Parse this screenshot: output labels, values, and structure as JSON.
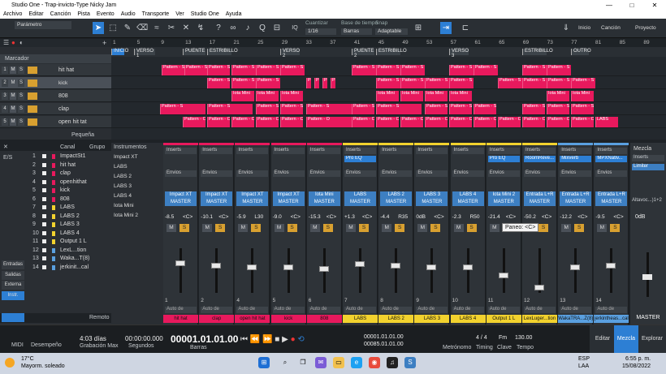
{
  "window": {
    "title": "Studio One - Trap-invicto-Type Nicky Jam",
    "min": "—",
    "max": "□",
    "close": "✕"
  },
  "menu": [
    "Archivo",
    "Editar",
    "Canción",
    "Pista",
    "Evento",
    "Audio",
    "Transporte",
    "Ver",
    "Studio One",
    "Ayuda"
  ],
  "toolbar": {
    "param": "Parámetro",
    "quantize_label": "Cuantizar",
    "quantize_value": "1/16",
    "timebase_label": "Base de tiempo",
    "timebase_value": "Barras",
    "snap_label": "Snap",
    "snap_value": "Adaptable",
    "iq": "IQ",
    "home": "Inicio",
    "song": "Canción",
    "project": "Proyecto"
  },
  "ruler": [
    "1",
    "5",
    "9",
    "13",
    "17",
    "21",
    "25",
    "29",
    "33",
    "37",
    "41",
    "45",
    "49",
    "53",
    "57",
    "61",
    "65",
    "69",
    "73",
    "77",
    "81",
    "85",
    "89"
  ],
  "markers": [
    {
      "label": "INICIO"
    },
    {
      "label": "VERSO 1"
    },
    {
      "label": "PUENTE"
    },
    {
      "label": "ESTRIBILLO"
    },
    {
      "label": "VERSO 2"
    },
    {
      "label": "PUENTE 2"
    },
    {
      "label": "ESTRIBILLO"
    },
    {
      "label": "VERSO 3"
    },
    {
      "label": "ESTRIBILLO"
    },
    {
      "label": "OUTRO"
    }
  ],
  "tracks_header": {
    "title": "Marcador"
  },
  "tracks": [
    {
      "n": "1",
      "name": "hit hat"
    },
    {
      "n": "2",
      "name": "kick"
    },
    {
      "n": "3",
      "name": "808"
    },
    {
      "n": "4",
      "name": "clap"
    },
    {
      "n": "5",
      "name": "open hit tat"
    }
  ],
  "clip_labels": {
    "pattern": "Pattern - S",
    "iota": "Iota Mini",
    "patO": "Pattern - O",
    "labs": "LABS"
  },
  "size": "Pequeña",
  "channel_list": {
    "header_canal": "Canal",
    "header_grupo": "Grupo",
    "header_inst": "Instrumentos",
    "items": [
      "ImpactSt1",
      "hit hat",
      "clap",
      "openhithat",
      "kick",
      "808",
      "LABS",
      "LABS 2",
      "LABS 3",
      "LABS 4",
      "Output 1 L",
      "LexL...tion",
      "Waka...T(8)",
      "jerkinit...cal"
    ],
    "nums": [
      "1",
      "2",
      "3",
      "4",
      "5",
      "6",
      "7",
      "8",
      "9",
      "10",
      "11",
      "12",
      "13",
      "14"
    ]
  },
  "instruments": [
    "Impact XT",
    "LABS",
    "LABS 2",
    "LABS 3",
    "LABS 4",
    "Iota Mini",
    "Iota Mini 2"
  ],
  "left_buttons": [
    "Entradas",
    "Salidas",
    "Externa",
    "Instr.",
    "Remoto"
  ],
  "left_header": [
    "E/S"
  ],
  "mixer_common": {
    "inserts": "Inserts",
    "envios": "Envios",
    "auto": "Auto de"
  },
  "strips": [
    {
      "inst": "Impact XT",
      "out": "MASTER",
      "vol": "-8.5",
      "pan": "<C>",
      "num": "1",
      "name": "hit hat",
      "col": "#e8195d"
    },
    {
      "inst": "Impact XT",
      "out": "MASTER",
      "vol": "-10.1",
      "pan": "<C>",
      "num": "2",
      "name": "clap",
      "col": "#e8195d"
    },
    {
      "inst": "Impact XT",
      "out": "MASTER",
      "vol": "-5.9",
      "pan": "L30",
      "num": "4",
      "name": "open hit hat",
      "col": "#e8195d"
    },
    {
      "inst": "Impact XT",
      "out": "MASTER",
      "vol": "-9.0",
      "pan": "<C>",
      "num": "5",
      "name": "kick",
      "col": "#e8195d"
    },
    {
      "inst": "Iota Mini",
      "out": "MASTER",
      "vol": "-15.3",
      "pan": "<C>",
      "num": "6",
      "name": "808",
      "col": "#e8195d"
    },
    {
      "inst": "LABS",
      "out": "MASTER",
      "vol": "+1.3",
      "pan": "<C>",
      "num": "7",
      "name": "LABS",
      "col": "#f2d22e",
      "ins": "Pro EQ"
    },
    {
      "inst": "LABS 2",
      "out": "MASTER",
      "vol": "-4.4",
      "pan": "R35",
      "num": "8",
      "name": "LABS 2",
      "col": "#f2d22e"
    },
    {
      "inst": "LABS 3",
      "out": "MASTER",
      "vol": "0dB",
      "pan": "<C>",
      "num": "9",
      "name": "LABS 3",
      "col": "#f2d22e"
    },
    {
      "inst": "LABS 4",
      "out": "MASTER",
      "vol": "-2.3",
      "pan": "R50",
      "num": "10",
      "name": "LABS 4",
      "col": "#f2d22e"
    },
    {
      "inst": "Iota Mini 2",
      "out": "MASTER",
      "vol": "-21.4",
      "pan": "<C>",
      "num": "11",
      "name": "Output 1 L",
      "col": "#f2d22e",
      "ins": "Pro EQ"
    },
    {
      "inst": "Entrada L+R",
      "out": "MASTER",
      "vol": "-50.2",
      "pan": "<C>",
      "num": "12",
      "name": "LexLuger...tion",
      "col": "#f2d22e",
      "ins": "RoomReve..."
    },
    {
      "inst": "Entrada L+R",
      "out": "MASTER",
      "vol": "-12.2",
      "pan": "<C>",
      "num": "13",
      "name": "WakaTRA...Z(8)",
      "col": "#5aa0e0",
      "ins": "Mixverb"
    },
    {
      "inst": "Entrada L+R",
      "out": "MASTER",
      "vol": "-9.5",
      "pan": "<C>",
      "num": "14",
      "name": "jerkintheas...cal",
      "col": "#5aa0e0",
      "ins": "MPXNativ..."
    }
  ],
  "pan_tooltip": "Paneo: <C>",
  "master": {
    "mezcla": "Mezcla",
    "inserts": "Inserts",
    "limiter": "Limiter",
    "out": "Altavoc...)1+2",
    "vol": "0dB",
    "name": "MASTER"
  },
  "transport": {
    "midi": "MIDI",
    "perf": "Desempeño",
    "rec_time": "4:03 días",
    "rec_label": "Grabación Max",
    "secs": "00:00:00.000",
    "secs_label": "Segundos",
    "bars": "00001.01.01.00",
    "bars_label": "Barras",
    "L": "00001.01.01.00",
    "R": "00085.01.01.00",
    "sig": "4 / 4",
    "timing": "Timing",
    "key": "Fm",
    "key_label": "Clave",
    "tempo": "130.00",
    "tempo_label": "Tempo",
    "metro": "Metrónomo",
    "edit": "Editar",
    "mix": "Mezcla",
    "browse": "Explorar"
  },
  "taskbar": {
    "temp": "17°C",
    "weather": "Mayorm. soleado",
    "lang": "ESP",
    "lang2": "LAA",
    "time": "6:55 p. m.",
    "date": "15/08/2022"
  }
}
